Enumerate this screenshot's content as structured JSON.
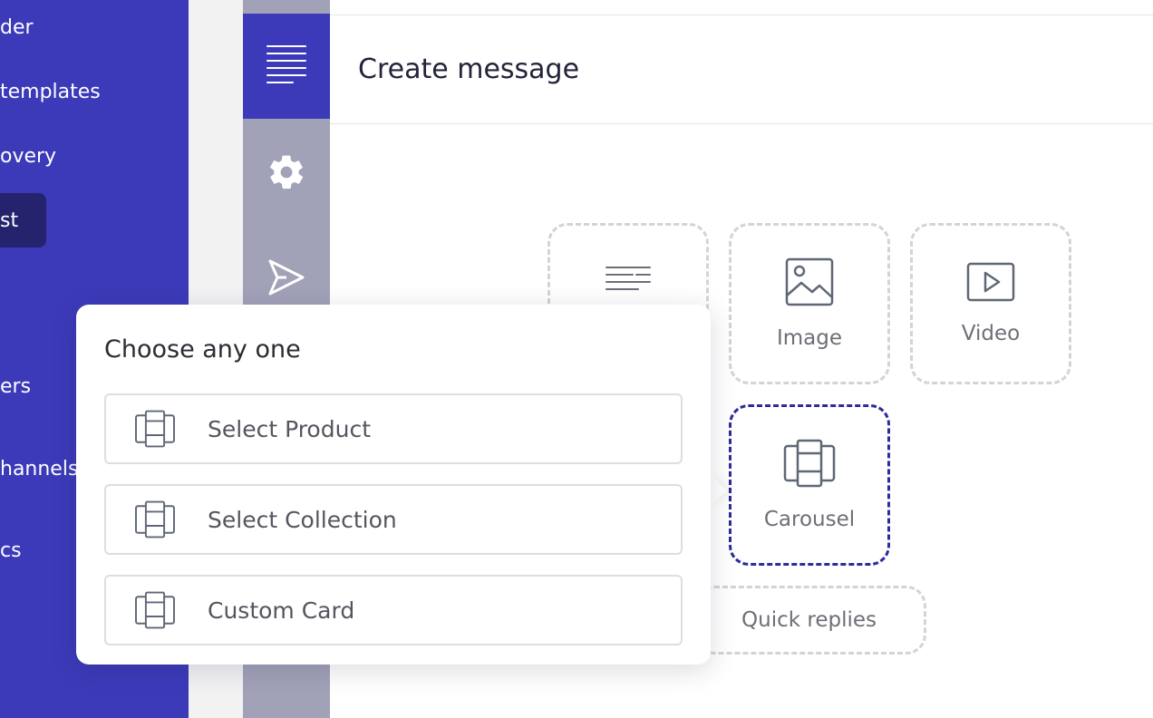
{
  "sidebar": {
    "items": [
      {
        "label": "der"
      },
      {
        "label": "templates"
      },
      {
        "label": "overy"
      },
      {
        "label": "st"
      },
      {
        "label": "ers"
      },
      {
        "label": "hannels"
      },
      {
        "label": "cs"
      }
    ]
  },
  "rail": {
    "icons": [
      "text-lines-icon",
      "gear-icon",
      "send-icon"
    ]
  },
  "main": {
    "title": "Create message",
    "tiles": [
      {
        "label": "",
        "icon": "text-lines-icon"
      },
      {
        "label": "Image",
        "icon": "image-icon"
      },
      {
        "label": "Video",
        "icon": "video-icon"
      },
      {
        "label": "Carousel",
        "icon": "carousel-icon"
      }
    ],
    "quick_replies_label": "Quick replies"
  },
  "popover": {
    "title": "Choose any one",
    "options": [
      {
        "label": "Select Product",
        "icon": "carousel-icon"
      },
      {
        "label": "Select Collection",
        "icon": "carousel-icon"
      },
      {
        "label": "Custom Card",
        "icon": "carousel-icon"
      }
    ]
  },
  "colors": {
    "brand": "#3c3ab8",
    "brand_dark": "#25236d",
    "rail": "#a1a1b8",
    "selected_border": "#2e2b9c"
  }
}
